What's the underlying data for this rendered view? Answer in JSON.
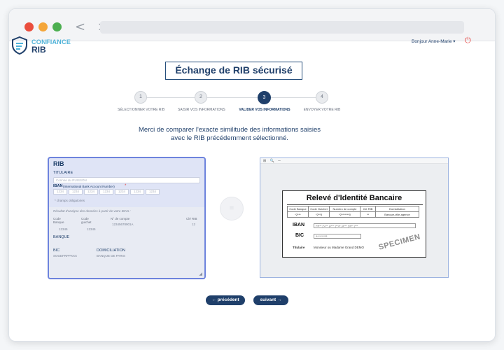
{
  "browser": {
    "nav_arrows": "< >"
  },
  "app": {
    "logo_line1": "CONFIANCE",
    "logo_line2": "RIB",
    "user_name": "Bonjour Anne-Marie ▾",
    "power_icon_glyph": "⏻"
  },
  "page_title": "Échange de RIB sécurisé",
  "steps": [
    {
      "number": "1",
      "label": "SÉLECTIONNER VOTRE RIB",
      "active": false
    },
    {
      "number": "2",
      "label": "SAISIR VOS INFORMATIONS",
      "active": false
    },
    {
      "number": "3",
      "label": "VALIDER VOS INFORMATIONS",
      "active": true
    },
    {
      "number": "4",
      "label": "ENVOYER VOTRE RIB",
      "active": false
    }
  ],
  "intro": {
    "line1": "Merci de comparer l'exacte similitude des informations saisies",
    "line2": "avec le RIB précédemment sélectionné."
  },
  "rib_form": {
    "title": "RIB",
    "titulaire_label": "TITULAIRE",
    "titulaire_value": "Corinne du RUISSON",
    "iban_label": "IBAN",
    "iban_sub": "(International Bank Account Number)",
    "iban_star": "*",
    "iban_values": [
      "1234",
      "1234",
      "1234",
      "1234",
      "1234",
      "1234",
      "1234"
    ],
    "required_note": "* champs obligatoires",
    "analysis_note": "Résultat d'analyse des données à partir de votre IBAN :",
    "code_banque_label": "Code Banque",
    "code_banque_value": "12345",
    "code_guichet_label": "Code guichet",
    "code_guichet_value": "12345",
    "no_compte_label": "N° de compte",
    "no_compte_value": "12345678901A",
    "cle_rib_label": "Clé RIB",
    "cle_rib_value": "12",
    "banque_label": "BANQUE",
    "bic_label": "BIC",
    "bic_value": "SOGEFRPPXXX",
    "domiciliation_label": "DOMICILIATION",
    "domiciliation_value": "BANQUE DE PARIS",
    "resize_glyph": "◢"
  },
  "compare_glyph": "=",
  "document": {
    "toolbar": "⊞ 🔍 ─",
    "title": "Relevé d'Identité Bancaire",
    "headers": [
      "Code Banque",
      "Code Guichet",
      "Numéro de compte",
      "Clé RIB",
      "Domiciliation"
    ],
    "values": [
      "*2***",
      "*2**5",
      "*2*******0",
      "**",
      "Banque-ville-agence"
    ],
    "iban_label": "IBAN",
    "iban_value": "FR**  |*2**  |2***  |**3*  |3***  |*8**  |***",
    "bic_label": "BIC",
    "bic_value": "A*******R",
    "titulaire_label": "Titulaire",
    "titulaire_value": "Monsieur ou Madame Grand DEMO",
    "specimen": "SPECIMEN"
  },
  "buttons": {
    "previous": "← précédent",
    "next": "suivant →"
  },
  "colors": {
    "primary": "#1f3f6a",
    "accent": "#4fb3d9",
    "panel_border": "#6d83dd",
    "danger": "#e53935"
  }
}
